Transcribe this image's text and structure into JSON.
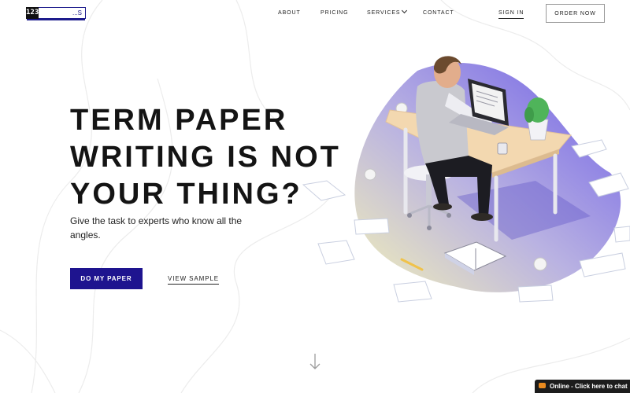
{
  "brand": {
    "logo_number": "123",
    "logo_text": "...S"
  },
  "nav": {
    "items": [
      {
        "label": "ABOUT"
      },
      {
        "label": "PRICING"
      },
      {
        "label": "SERVICES"
      },
      {
        "label": "CONTACT"
      }
    ],
    "sign_in": "SIGN IN",
    "order_now": "ORDER NOW"
  },
  "hero": {
    "title_lines": [
      "TERM PAPER",
      "WRITING IS NOT",
      "YOUR THING?"
    ],
    "subtitle": "Give the task to experts who know all the angles.",
    "primary_cta": "DO MY PAPER",
    "secondary_cta": "VIEW SAMPLE"
  },
  "chat_widget": {
    "label": "Online - Click here to chat"
  },
  "icons": {
    "services_dropdown": "chevron-down-icon",
    "scroll": "arrow-down-icon",
    "chat": "chat-bubble-icon"
  },
  "colors": {
    "accent": "#1e148f",
    "illustration_blob": "#7b6fe8",
    "text": "#141414",
    "chat_bar": "#1c1c1c",
    "chat_icon": "#e98a1f"
  }
}
